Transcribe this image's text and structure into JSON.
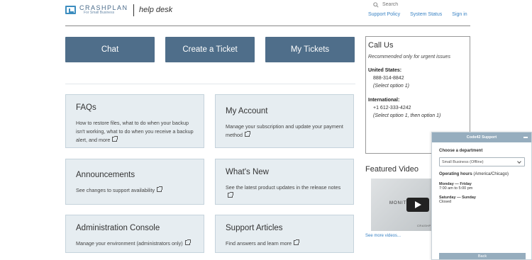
{
  "header": {
    "logo_name": "CRASHPLAN",
    "logo_sub": "For Small Business",
    "help_label": "help desk",
    "search_placeholder": "Search",
    "links": [
      "Support Policy",
      "System Status",
      "Sign in"
    ]
  },
  "buttons": [
    "Chat",
    "Create a Ticket",
    "My Tickets"
  ],
  "cards": [
    {
      "title": "FAQs",
      "desc": "How to restore files, what to do when your backup isn't working, what to do when you receive a backup alert, and more"
    },
    {
      "title": "My Account",
      "desc": "Manage your subscription and update your payment method"
    },
    {
      "title": "Announcements",
      "desc": "See changes to support availability"
    },
    {
      "title": "What's New",
      "desc": "See the latest product updates in the release notes"
    },
    {
      "title": "Administration Console",
      "desc": "Manage your environment (administrators only)"
    },
    {
      "title": "Support Articles",
      "desc": "Find answers and learn more"
    }
  ],
  "callus": {
    "title": "Call Us",
    "note": "Recommended only for urgent issues",
    "us_label": "United States:",
    "us_number": "888-314-8842",
    "us_option": "(Select option 1)",
    "intl_label": "International:",
    "intl_number": "+1 612-333-4242",
    "intl_option": "(Select option 1, then option 1)"
  },
  "video": {
    "section_title": "Featured Video",
    "overlay_text": "MONITOR",
    "brand": "CRASHPLAN",
    "see_more": "See more videos..."
  },
  "widget": {
    "title": "Code42 Support",
    "dept_label": "Choose a department",
    "dept_value": "Small Business (Offline)",
    "hours_label": "Operating hours",
    "hours_tz": "(America/Chicago)",
    "day1": "Monday — Friday",
    "time1": "7:00 am to 5:00 pm",
    "day2": "Saturday — Sunday",
    "time2": "Closed",
    "back_label": "Back"
  }
}
